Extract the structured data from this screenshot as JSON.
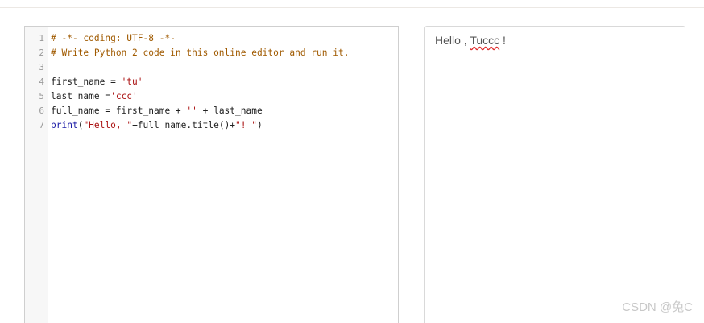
{
  "editor": {
    "line_numbers": [
      "1",
      "2",
      "3",
      "4",
      "5",
      "6",
      "7"
    ],
    "lines": [
      [
        {
          "t": "comment",
          "v": "# -*- coding: UTF-8 -*-"
        }
      ],
      [
        {
          "t": "comment",
          "v": "# Write Python 2 code in this online editor and run it."
        }
      ],
      [
        {
          "t": "plain",
          "v": ""
        }
      ],
      [
        {
          "t": "plain",
          "v": "first_name = "
        },
        {
          "t": "string",
          "v": "'tu'"
        }
      ],
      [
        {
          "t": "plain",
          "v": "last_name ="
        },
        {
          "t": "string",
          "v": "'ccc'"
        }
      ],
      [
        {
          "t": "plain",
          "v": "full_name = first_name + "
        },
        {
          "t": "string",
          "v": "''"
        },
        {
          "t": "plain",
          "v": " + last_name"
        }
      ],
      [
        {
          "t": "keyword",
          "v": "print"
        },
        {
          "t": "plain",
          "v": "("
        },
        {
          "t": "string",
          "v": "\"Hello, \""
        },
        {
          "t": "plain",
          "v": "+full_name.title()+"
        },
        {
          "t": "string",
          "v": "\"! \""
        },
        {
          "t": "plain",
          "v": ")"
        }
      ]
    ]
  },
  "output": {
    "prefix": "Hello , ",
    "name": "Tuccc",
    "suffix": " !"
  },
  "watermark": {
    "text": "CSDN @兔C"
  }
}
